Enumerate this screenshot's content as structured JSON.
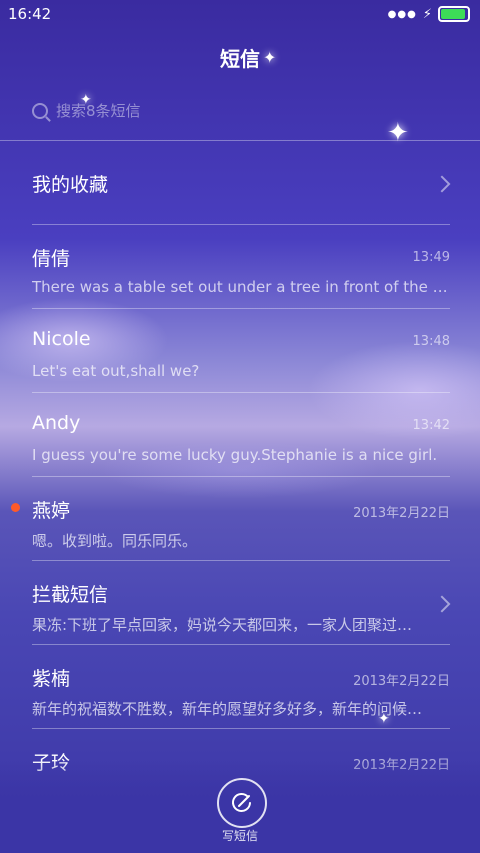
{
  "status": {
    "time": "16:42",
    "icons": [
      "dots-icon",
      "charging-bolt-icon",
      "battery-icon"
    ]
  },
  "header": {
    "title": "短信"
  },
  "search": {
    "placeholder": "搜索8条短信"
  },
  "favorites": {
    "label": "我的收藏"
  },
  "threads": [
    {
      "name": "倩倩",
      "time": "13:49",
      "preview": "There was a table set out under a tree in front of the ho…",
      "unread": false
    },
    {
      "name": "Nicole",
      "time": "13:48",
      "preview": "Let's eat out,shall we?",
      "unread": false
    },
    {
      "name": "Andy",
      "time": "13:42",
      "preview": "I guess you're some lucky guy.Stephanie is a nice girl.",
      "unread": false
    },
    {
      "name": "燕婷",
      "time": "2013年2月22日",
      "preview": "嗯。收到啦。同乐同乐。",
      "unread": true
    },
    {
      "name": "拦截短信",
      "time": "",
      "preview": "果冻:下班了早点回家，妈说今天都回来，一家人团聚过…",
      "unread": false
    },
    {
      "name": "紫楠",
      "time": "2013年2月22日",
      "preview": "新年的祝福数不胜数，新年的愿望好多好多，新年的问候…",
      "unread": false
    },
    {
      "name": "子玲",
      "time": "2013年2月22日",
      "preview": "",
      "unread": false
    }
  ],
  "compose": {
    "label": "写短信"
  },
  "colors": {
    "unread_dot": "#ff5a2a",
    "battery": "#3ddc57"
  }
}
